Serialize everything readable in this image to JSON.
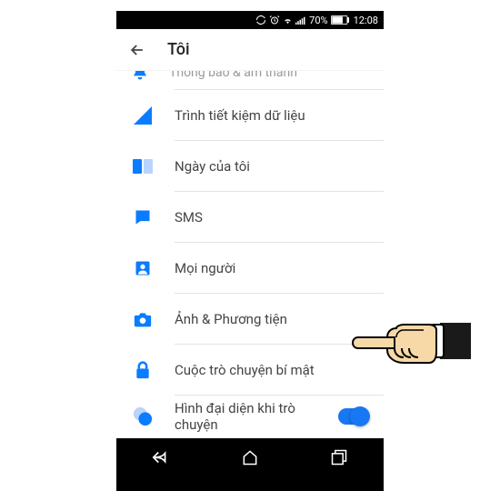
{
  "status": {
    "battery_text": "70%",
    "time": "12:08"
  },
  "header": {
    "title": "Tôi"
  },
  "partial_row": {
    "label": "Thông báo & âm thanh"
  },
  "rows": [
    {
      "icon": "data-saver-icon",
      "label": "Trình tiết kiệm dữ liệu"
    },
    {
      "icon": "myday-icon",
      "label": "Ngày của tôi"
    },
    {
      "icon": "sms-icon",
      "label": "SMS"
    },
    {
      "icon": "people-icon",
      "label": "Mọi người"
    },
    {
      "icon": "camera-icon",
      "label": "Ảnh & Phương tiện"
    },
    {
      "icon": "lock-icon",
      "label": "Cuộc trò chuyện bí mật"
    },
    {
      "icon": "bubble-icon",
      "label": "Hình đại diện khi trò chuyện",
      "toggle": true
    }
  ],
  "colors": {
    "accent": "#1877f2",
    "blue": "#0a7cff"
  }
}
